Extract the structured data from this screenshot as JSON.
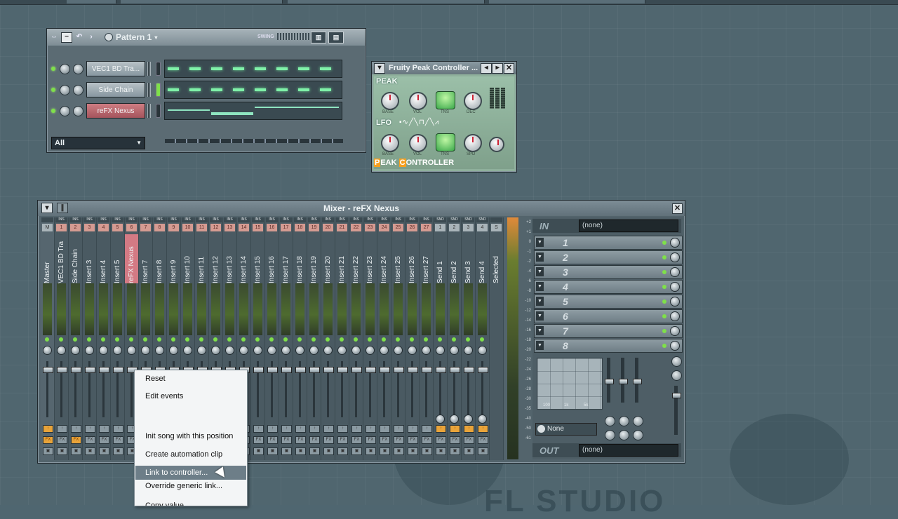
{
  "step_sequencer": {
    "pattern_name": "Pattern 1",
    "swing_label": "SWING",
    "channels": [
      {
        "name": "VEC1 BD Tra...",
        "mode": "steps",
        "selected": false
      },
      {
        "name": "Side Chain",
        "mode": "steps",
        "selected": true
      },
      {
        "name": "reFX Nexus",
        "mode": "pianoroll",
        "selected": false
      }
    ],
    "filter_label": "All"
  },
  "peak_controller": {
    "title": "Fruity Peak Controller ...",
    "peak_label": "PEAK",
    "lfo_label": "LFO",
    "peak_knobs": [
      "BASE",
      "VOL",
      "TNS",
      "DEC"
    ],
    "lfo_knobs": [
      "BASE",
      "VOL",
      "TNS",
      "SPD"
    ],
    "footer_part1": "EAK",
    "footer_part2": "ONTROLLER",
    "footer_p": "P",
    "footer_c": "C"
  },
  "mixer": {
    "title": "Mixer - reFX Nexus",
    "strips": [
      {
        "name": "Master",
        "tag": "",
        "num": "M"
      },
      {
        "name": "VEC1 BD Tra",
        "tag": "INS",
        "num": "1"
      },
      {
        "name": "Side Chain",
        "tag": "INS",
        "num": "2"
      },
      {
        "name": "Insert 3",
        "tag": "INS",
        "num": "3"
      },
      {
        "name": "Insert 4",
        "tag": "INS",
        "num": "4"
      },
      {
        "name": "Insert 5",
        "tag": "INS",
        "num": "5"
      },
      {
        "name": "reFX Nexus",
        "tag": "INS",
        "num": "6"
      },
      {
        "name": "Insert 7",
        "tag": "INS",
        "num": "7"
      },
      {
        "name": "Insert 8",
        "tag": "INS",
        "num": "8"
      },
      {
        "name": "Insert 9",
        "tag": "INS",
        "num": "9"
      },
      {
        "name": "Insert 10",
        "tag": "INS",
        "num": "10"
      },
      {
        "name": "Insert 11",
        "tag": "INS",
        "num": "11"
      },
      {
        "name": "Insert 12",
        "tag": "INS",
        "num": "12"
      },
      {
        "name": "Insert 13",
        "tag": "INS",
        "num": "13"
      },
      {
        "name": "Insert 14",
        "tag": "INS",
        "num": "14"
      },
      {
        "name": "Insert 15",
        "tag": "INS",
        "num": "15"
      },
      {
        "name": "Insert 16",
        "tag": "INS",
        "num": "16"
      },
      {
        "name": "Insert 17",
        "tag": "INS",
        "num": "17"
      },
      {
        "name": "Insert 18",
        "tag": "INS",
        "num": "18"
      },
      {
        "name": "Insert 19",
        "tag": "INS",
        "num": "19"
      },
      {
        "name": "Insert 20",
        "tag": "INS",
        "num": "20"
      },
      {
        "name": "Insert 21",
        "tag": "INS",
        "num": "21"
      },
      {
        "name": "Insert 22",
        "tag": "INS",
        "num": "22"
      },
      {
        "name": "Insert 23",
        "tag": "INS",
        "num": "23"
      },
      {
        "name": "Insert 24",
        "tag": "INS",
        "num": "24"
      },
      {
        "name": "Insert 25",
        "tag": "INS",
        "num": "25"
      },
      {
        "name": "Insert 26",
        "tag": "INS",
        "num": "26"
      },
      {
        "name": "Insert 27",
        "tag": "INS",
        "num": "27"
      },
      {
        "name": "Send 1",
        "tag": "SND",
        "num": "1"
      },
      {
        "name": "Send 2",
        "tag": "SND",
        "num": "2"
      },
      {
        "name": "Send 3",
        "tag": "SND",
        "num": "3"
      },
      {
        "name": "Send 4",
        "tag": "SND",
        "num": "4"
      },
      {
        "name": "Selected",
        "tag": "",
        "num": "S"
      }
    ],
    "selected_index": 6,
    "scale": [
      "+2",
      "+1",
      "0",
      "-1",
      "-2",
      "-4",
      "-6",
      "-8",
      "-10",
      "-12",
      "-14",
      "-16",
      "-18",
      "-20",
      "-22",
      "-24",
      "-26",
      "-28",
      "-30",
      "-35",
      "-40",
      "-50",
      "-61"
    ],
    "in_label": "IN",
    "in_value": "(none)",
    "fx_slots": [
      "1",
      "2",
      "3",
      "4",
      "5",
      "6",
      "7",
      "8"
    ],
    "eq_labels": [
      "100",
      "1k",
      "5k"
    ],
    "none_label": "None",
    "out_label": "OUT",
    "out_value": "(none)"
  },
  "context_menu": {
    "items": [
      {
        "label": "Reset",
        "state": "normal"
      },
      {
        "label": "Edit events",
        "state": "normal"
      },
      {
        "label": "",
        "state": "sep"
      },
      {
        "label": "Init song with this position",
        "state": "normal"
      },
      {
        "label": "Create automation clip",
        "state": "normal"
      },
      {
        "label": "Link to controller...",
        "state": "hover"
      },
      {
        "label": "Override generic link...",
        "state": "normal"
      },
      {
        "label": "Copy value",
        "state": "normal"
      }
    ]
  },
  "watermark": "FL STUDIO"
}
